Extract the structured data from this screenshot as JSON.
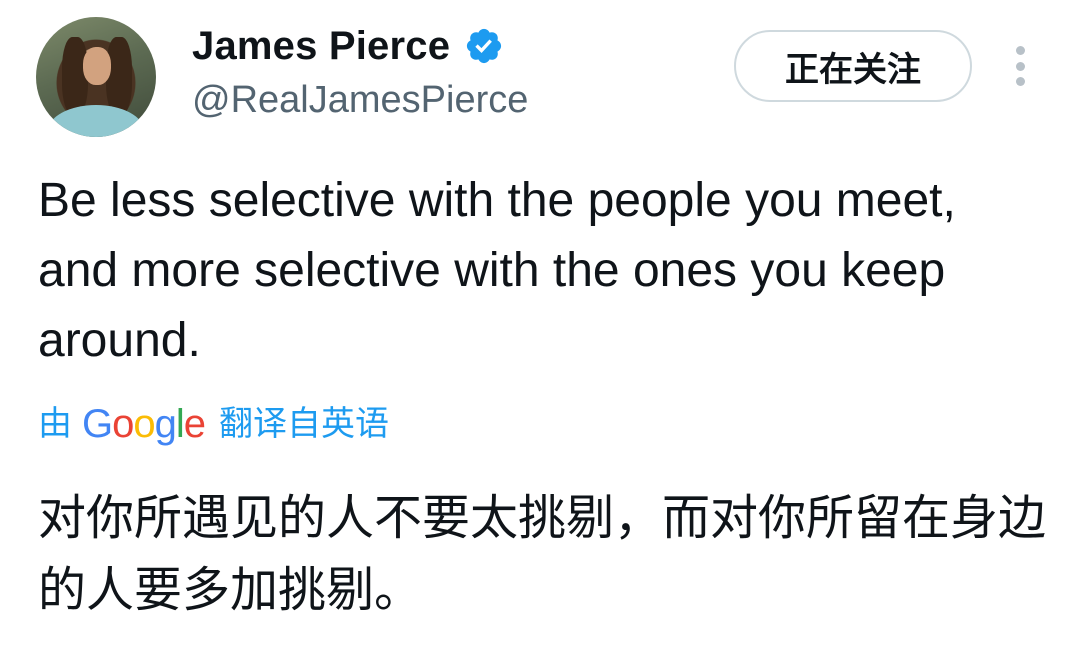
{
  "author": {
    "display_name": "James Pierce",
    "handle": "@RealJamesPierce",
    "verified_icon": "verified-badge-icon",
    "avatar_icon": "profile-photo"
  },
  "actions": {
    "follow_label": "正在关注",
    "more_icon": "more-vertical-icon"
  },
  "tweet": {
    "text": "Be less selective with the people you meet, and more selective with the ones you keep around."
  },
  "translation": {
    "prefix": "由",
    "provider_letters": [
      "G",
      "o",
      "o",
      "g",
      "l",
      "e"
    ],
    "suffix": "翻译自英语",
    "text": "对你所遇见的人不要太挑剔，而对你所留在身边的人要多加挑剔。"
  },
  "colors": {
    "link": "#1d9bf0",
    "verified": "#1d9bf0",
    "secondary_text": "#536471",
    "google_blue": "#4285f4",
    "google_red": "#ea4335",
    "google_yellow": "#fbbc05",
    "google_green": "#34a853"
  }
}
